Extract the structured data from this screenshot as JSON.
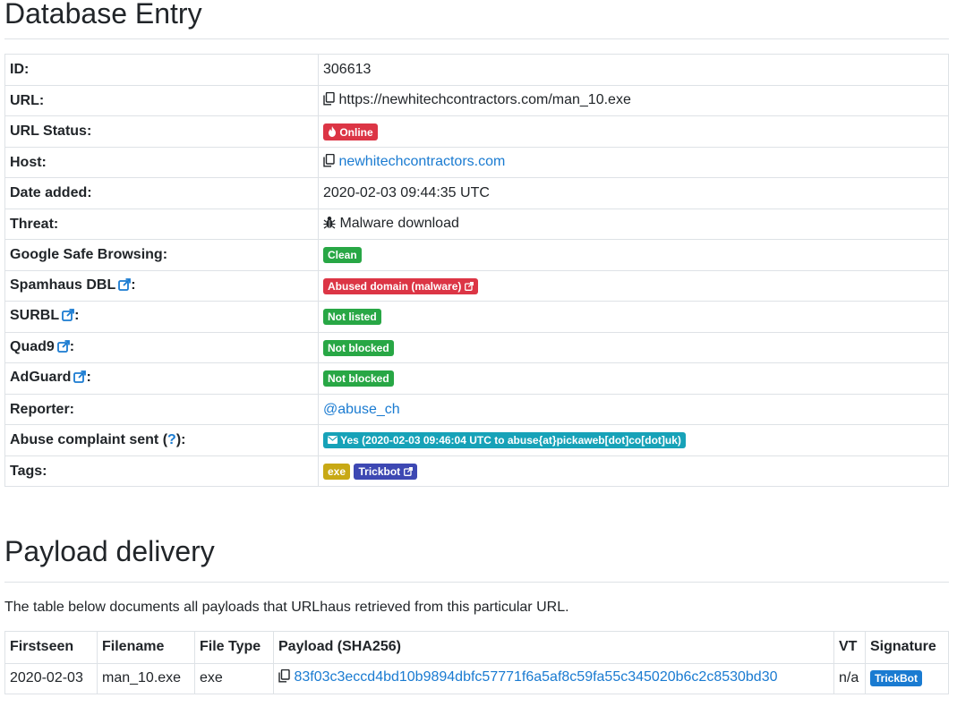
{
  "title": "Database Entry",
  "entry": {
    "id_label": "ID:",
    "id_value": "306613",
    "url_label": "URL:",
    "url_value": "https://newhitechcontractors.com/man_10.exe",
    "status_label": "URL Status:",
    "status_value": "Online",
    "host_label": "Host:",
    "host_value": "newhitechcontractors.com",
    "date_label": "Date added:",
    "date_value": "2020-02-03 09:44:35 UTC",
    "threat_label": "Threat:",
    "threat_value": "Malware download",
    "gsb_label": "Google Safe Browsing:",
    "gsb_value": "Clean",
    "spamhaus_label": "Spamhaus DBL",
    "spamhaus_value": "Abused domain (malware)",
    "surbl_label": "SURBL",
    "surbl_value": "Not listed",
    "quad9_label": "Quad9",
    "quad9_value": "Not blocked",
    "adguard_label": "AdGuard",
    "adguard_value": "Not blocked",
    "reporter_label": "Reporter:",
    "reporter_value": "@abuse_ch",
    "abuse_label": "Abuse complaint sent (",
    "abuse_q": "?",
    "abuse_label_end": "):",
    "abuse_value": "Yes (2020-02-03 09:46:04 UTC to abuse{at}pickaweb[dot]co[dot]uk)",
    "tags_label": "Tags:",
    "tag1": "exe",
    "tag2": "Trickbot",
    "colon": ":"
  },
  "payload": {
    "title": "Payload delivery",
    "description": "The table below documents all payloads that URLhaus retrieved from this particular URL.",
    "headers": [
      "Firstseen",
      "Filename",
      "File Type",
      "Payload (SHA256)",
      "VT",
      "Signature"
    ],
    "rows": [
      {
        "firstseen": "2020-02-03",
        "filename": "man_10.exe",
        "filetype": "exe",
        "sha256": "83f03c3eccd4bd10b9894dbfc57771f6a5af8c59fa55c345020b6c2c8530bd30",
        "vt": "n/a",
        "signature": "TrickBot"
      }
    ]
  },
  "colors": {
    "link": "#1a7bd1",
    "danger": "#dc3545",
    "success": "#28a745",
    "info": "#17a2b8",
    "warning": "#c8a915",
    "indigo": "#3d48b3"
  },
  "icons": [
    "copy-icon",
    "fire-icon",
    "bug-icon",
    "external-link-icon",
    "envelope-icon"
  ]
}
